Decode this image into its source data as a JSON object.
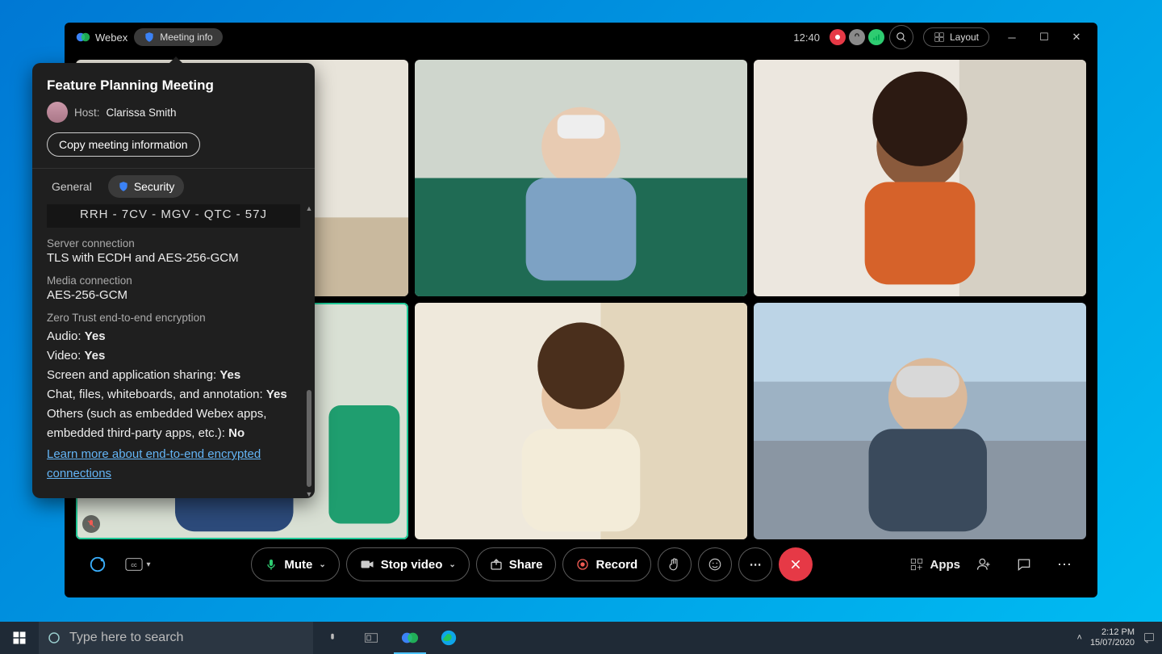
{
  "titlebar": {
    "brand": "Webex",
    "meeting_info_label": "Meeting info",
    "time": "12:40",
    "layout_label": "Layout",
    "status_dots": {
      "record": "#e63946",
      "key": "#8a8a8a",
      "signal": "#2ecc71"
    }
  },
  "toolbar": {
    "mute_label": "Mute",
    "stop_video_label": "Stop video",
    "share_label": "Share",
    "record_label": "Record",
    "apps_label": "Apps"
  },
  "popover": {
    "title": "Feature Planning Meeting",
    "host_prefix": "Host:",
    "host_name": "Clarissa Smith",
    "copy_label": "Copy meeting information",
    "tabs": {
      "general": "General",
      "security": "Security"
    },
    "security": {
      "code_fragment": "RRH - 7CV - MGV - QTC - 57J",
      "server_label": "Server connection",
      "server_value": "TLS with ECDH and AES-256-GCM",
      "media_label": "Media connection",
      "media_value": "AES-256-GCM",
      "e2e_label": "Zero Trust end-to-end encryption",
      "audio_label": "Audio:",
      "audio_value": "Yes",
      "video_label": "Video:",
      "video_value": "Yes",
      "screen_label": "Screen and application sharing:",
      "screen_value": "Yes",
      "chat_label": "Chat, files, whiteboards, and annotation:",
      "chat_value": "Yes",
      "others_label": "Others (such as embedded Webex apps, embedded third-party apps, etc.):",
      "others_value": "No",
      "learn_more": "Learn more about end-to-end encrypted connections"
    }
  },
  "taskbar": {
    "search_placeholder": "Type here to search",
    "clock_time": "2:12 PM",
    "clock_date": "15/07/2020"
  }
}
